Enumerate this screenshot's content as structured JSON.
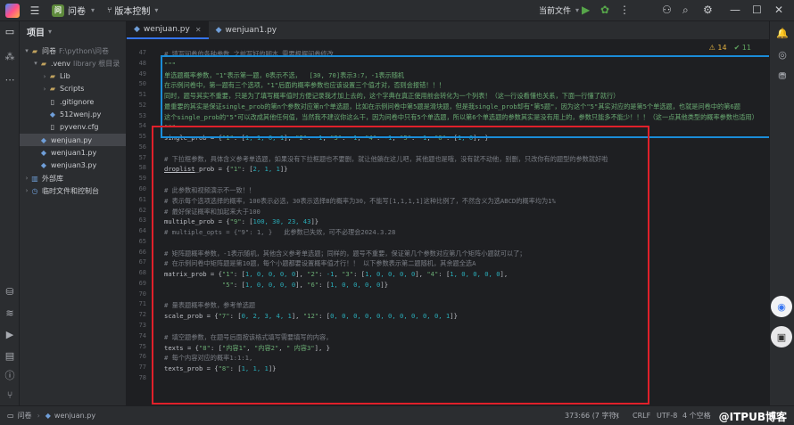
{
  "titlebar": {
    "menu_icon": "hamburger-menu-icon",
    "project_badge": "问",
    "project_name": "问卷",
    "vcs_label": "版本控制",
    "run_config": "当前文件"
  },
  "project_panel": {
    "title": "项目",
    "tree": [
      {
        "level": 0,
        "arrow": "▾",
        "icon": "folder",
        "label": "问卷",
        "hint": "F:\\python\\问卷",
        "sel": false
      },
      {
        "level": 1,
        "arrow": "▾",
        "icon": "folder",
        "label": ".venv",
        "hint": "library 根目录",
        "sel": false
      },
      {
        "level": 2,
        "arrow": "›",
        "icon": "folder",
        "label": "Lib",
        "hint": "",
        "sel": false
      },
      {
        "level": 2,
        "arrow": "›",
        "icon": "folder",
        "label": "Scripts",
        "hint": "",
        "sel": false
      },
      {
        "level": 2,
        "arrow": "",
        "icon": "file",
        "label": ".gitignore",
        "hint": "",
        "sel": false
      },
      {
        "level": 2,
        "arrow": "",
        "icon": "py",
        "label": "512wenj.py",
        "hint": "",
        "sel": false
      },
      {
        "level": 2,
        "arrow": "",
        "icon": "file",
        "label": "pyvenv.cfg",
        "hint": "",
        "sel": false
      },
      {
        "level": 1,
        "arrow": "",
        "icon": "py",
        "label": "wenjuan.py",
        "hint": "",
        "sel": true
      },
      {
        "level": 1,
        "arrow": "",
        "icon": "py",
        "label": "wenjuan1.py",
        "hint": "",
        "sel": false
      },
      {
        "level": 1,
        "arrow": "",
        "icon": "py",
        "label": "wenjuan3.py",
        "hint": "",
        "sel": false
      },
      {
        "level": 0,
        "arrow": "›",
        "icon": "lib",
        "label": "外部库",
        "hint": "",
        "sel": false
      },
      {
        "level": 0,
        "arrow": "›",
        "icon": "scratch",
        "label": "临时文件和控制台",
        "hint": "",
        "sel": false
      }
    ]
  },
  "tabs": [
    {
      "label": "wenjuan.py",
      "active": true
    },
    {
      "label": "wenjuan1.py",
      "active": false
    }
  ],
  "inspections": {
    "warnings": "⚠ 14",
    "weak": "✔ 11"
  },
  "code_lines": [
    {
      "n": "47",
      "parts": [
        {
          "c": "cm",
          "t": "# 填写问卷的各种参数 之前写好的脚本 需要根据问卷修改"
        }
      ]
    },
    {
      "n": "48",
      "parts": [
        {
          "c": "docstr",
          "t": "\"\"\""
        }
      ]
    },
    {
      "n": "49",
      "parts": [
        {
          "c": "docstr",
          "t": "单选题概率参数，\"1\"表示第一题，0表示不选，  [30, 70]表示3:7，-1表示随机"
        }
      ]
    },
    {
      "n": "50",
      "parts": [
        {
          "c": "docstr",
          "t": "在示例问卷中，第一题有三个选项，\"1\"后面的概率参数也应该设置三个值才对，否则会报错！！！"
        }
      ]
    },
    {
      "n": "51",
      "parts": [
        {
          "c": "docstr",
          "t": "同时，题号其实不重要，只是为了填写概率值时方便记录我才加上去的，这个字典在真正使用前会转化为一个列表！（这一行设看懂也关系，下面一行懂了就行）"
        }
      ]
    },
    {
      "n": "52",
      "parts": [
        {
          "c": "docstr",
          "t": "最重要的其实是保证single_prob的第n个参数对应第n个单选题，比如在示例问卷中第5题是滑块题，但是我single_prob却有\"第5题\"，因为这个\"5\"其实对应的是第5个单选题，也就是问卷中的第6题"
        }
      ]
    },
    {
      "n": "53",
      "parts": [
        {
          "c": "docstr",
          "t": "这个single_prob的\"5\"可以改成其他任何值，当然我不建议你这么干，因为问卷中只有5个单选题，所以第6个单选题的参数其实是没有用上的，参数只能多不能少！！！（这一点其他类型的概率参数也适用）"
        }
      ]
    },
    {
      "n": "54",
      "parts": [
        {
          "c": "docstr",
          "t": "\"\"\""
        }
      ]
    },
    {
      "n": "55",
      "parts": [
        {
          "c": "",
          "t": "single_prob = {"
        },
        {
          "c": "str",
          "t": "\"1\""
        },
        {
          "c": "",
          "t": ": ["
        },
        {
          "c": "num",
          "t": "1, 1, 0, 1"
        },
        {
          "c": "",
          "t": "], "
        },
        {
          "c": "str",
          "t": "\"2\""
        },
        {
          "c": "",
          "t": ": "
        },
        {
          "c": "num",
          "t": "-1"
        },
        {
          "c": "",
          "t": ", "
        },
        {
          "c": "str",
          "t": "\"3\""
        },
        {
          "c": "",
          "t": ": "
        },
        {
          "c": "num",
          "t": "-1"
        },
        {
          "c": "",
          "t": ", "
        },
        {
          "c": "str",
          "t": "\"4\""
        },
        {
          "c": "",
          "t": ": "
        },
        {
          "c": "num",
          "t": "-1"
        },
        {
          "c": "",
          "t": ", "
        },
        {
          "c": "str",
          "t": "\"5\""
        },
        {
          "c": "",
          "t": ": "
        },
        {
          "c": "num",
          "t": "-1"
        },
        {
          "c": "",
          "t": ", "
        },
        {
          "c": "str",
          "t": "\"6\""
        },
        {
          "c": "",
          "t": ": ["
        },
        {
          "c": "num",
          "t": "1, 0"
        },
        {
          "c": "",
          "t": "], }"
        }
      ]
    },
    {
      "n": "56",
      "parts": []
    },
    {
      "n": "57",
      "parts": [
        {
          "c": "cm",
          "t": "# 下拉框参数，具体含义参考单选题，如果没有下拉框题也不要删，就让他躺在这儿吧，其他题也是哦，没有就不动他，别删，只改你有的题型的参数就好啦"
        }
      ]
    },
    {
      "n": "58",
      "parts": [
        {
          "c": "fn",
          "t": "droplist"
        },
        {
          "c": "",
          "t": "_prob = {"
        },
        {
          "c": "str",
          "t": "\"1\""
        },
        {
          "c": "",
          "t": ": ["
        },
        {
          "c": "num",
          "t": "2, 1, 1"
        },
        {
          "c": "",
          "t": "]}"
        }
      ]
    },
    {
      "n": "59",
      "parts": []
    },
    {
      "n": "60",
      "parts": [
        {
          "c": "cm",
          "t": "# 此参数和视频演示不一致！！"
        }
      ]
    },
    {
      "n": "61",
      "parts": [
        {
          "c": "cm",
          "t": "# 表示每个选项选择的概率，100表示必选，30表示选择B的概率为30，不能写[1,1,1,1]这种比例了，不然含义为选ABCD的概率均为1%"
        }
      ]
    },
    {
      "n": "62",
      "parts": [
        {
          "c": "cm",
          "t": "# 最好保证概率和加起来大于100"
        }
      ]
    },
    {
      "n": "63",
      "parts": [
        {
          "c": "",
          "t": "multiple_prob = {"
        },
        {
          "c": "str",
          "t": "\"9\""
        },
        {
          "c": "",
          "t": ": ["
        },
        {
          "c": "num",
          "t": "100, 30, 23, 43"
        },
        {
          "c": "",
          "t": "]}"
        }
      ]
    },
    {
      "n": "64",
      "parts": [
        {
          "c": "cm",
          "t": "# multiple_opts = {\"9\": 1, }   此参数已失效，可不必理会2024.3.28"
        }
      ]
    },
    {
      "n": "65",
      "parts": []
    },
    {
      "n": "66",
      "parts": [
        {
          "c": "cm",
          "t": "# 矩阵题概率参数，-1表示随机，其他含义参考单选题；同样的，题号不重要，保证第几个参数对应第几个矩阵小题就可以了；"
        }
      ]
    },
    {
      "n": "67",
      "parts": [
        {
          "c": "cm",
          "t": "# 在示例问卷中矩阵题是第10题，每个小题都要设置概率值才行！！ 以下参数表示第二题随机，其余题全选A"
        }
      ]
    },
    {
      "n": "68",
      "parts": [
        {
          "c": "",
          "t": "matrix_prob = {"
        },
        {
          "c": "str",
          "t": "\"1\""
        },
        {
          "c": "",
          "t": ": ["
        },
        {
          "c": "num",
          "t": "1, 0, 0, 0, 0"
        },
        {
          "c": "",
          "t": "], "
        },
        {
          "c": "str",
          "t": "\"2\""
        },
        {
          "c": "",
          "t": ": "
        },
        {
          "c": "num",
          "t": "-1"
        },
        {
          "c": "",
          "t": ", "
        },
        {
          "c": "str",
          "t": "\"3\""
        },
        {
          "c": "",
          "t": ": ["
        },
        {
          "c": "num",
          "t": "1, 0, 0, 0, 0"
        },
        {
          "c": "",
          "t": "], "
        },
        {
          "c": "str",
          "t": "\"4\""
        },
        {
          "c": "",
          "t": ": ["
        },
        {
          "c": "num",
          "t": "1, 0, 0, 0, 0"
        },
        {
          "c": "",
          "t": "],"
        }
      ]
    },
    {
      "n": "69",
      "parts": [
        {
          "c": "",
          "t": "               "
        },
        {
          "c": "str",
          "t": "\"5\""
        },
        {
          "c": "",
          "t": ": ["
        },
        {
          "c": "num",
          "t": "1, 0, 0, 0, 0"
        },
        {
          "c": "",
          "t": "], "
        },
        {
          "c": "str",
          "t": "\"6\""
        },
        {
          "c": "",
          "t": ": ["
        },
        {
          "c": "num",
          "t": "1, 0, 0, 0, 0"
        },
        {
          "c": "",
          "t": "]}"
        }
      ]
    },
    {
      "n": "70",
      "parts": []
    },
    {
      "n": "71",
      "parts": [
        {
          "c": "cm",
          "t": "# 量表题概率参数，参考单选题"
        }
      ]
    },
    {
      "n": "72",
      "parts": [
        {
          "c": "",
          "t": "scale_prob = {"
        },
        {
          "c": "str",
          "t": "\"7\""
        },
        {
          "c": "",
          "t": ": ["
        },
        {
          "c": "num",
          "t": "0, 2, 3, 4, 1"
        },
        {
          "c": "",
          "t": "], "
        },
        {
          "c": "str",
          "t": "\"12\""
        },
        {
          "c": "",
          "t": ": ["
        },
        {
          "c": "num",
          "t": "0, 0, 0, 0, 0, 0, 0, 0, 0, 0, 1"
        },
        {
          "c": "",
          "t": "]}"
        }
      ]
    },
    {
      "n": "73",
      "parts": []
    },
    {
      "n": "74",
      "parts": [
        {
          "c": "cm",
          "t": "# 填空题参数，在题号后面按该格式填写需要填写的内容，"
        }
      ]
    },
    {
      "n": "75",
      "parts": [
        {
          "c": "",
          "t": "texts = {"
        },
        {
          "c": "str",
          "t": "\"8\""
        },
        {
          "c": "",
          "t": ": ["
        },
        {
          "c": "str",
          "t": "\"内容1\""
        },
        {
          "c": "",
          "t": ", "
        },
        {
          "c": "str",
          "t": "\"内容2\""
        },
        {
          "c": "",
          "t": ", "
        },
        {
          "c": "str",
          "t": "\" 内容3\""
        },
        {
          "c": "",
          "t": "], }"
        }
      ]
    },
    {
      "n": "76",
      "parts": [
        {
          "c": "cm",
          "t": "# 每个内容对应的概率1:1:1,"
        }
      ]
    },
    {
      "n": "77",
      "parts": [
        {
          "c": "",
          "t": "texts_prob = {"
        },
        {
          "c": "str",
          "t": "\"8\""
        },
        {
          "c": "",
          "t": ": ["
        },
        {
          "c": "num",
          "t": "1, 1, 1"
        },
        {
          "c": "",
          "t": "]}"
        }
      ]
    },
    {
      "n": "78",
      "parts": []
    }
  ],
  "statusbar": {
    "breadcrumb_project": "问卷",
    "breadcrumb_file": "wenjuan.py",
    "position": "373:66 (7 字符)",
    "line_sep": "CRLF",
    "encoding": "UTF-8",
    "indent": "4 个空格",
    "watermark": "@ITPUB博客"
  },
  "colors": {
    "highlight_red": "#e0202a",
    "highlight_blue": "#1a8cd8",
    "accent": "#3574f0"
  }
}
